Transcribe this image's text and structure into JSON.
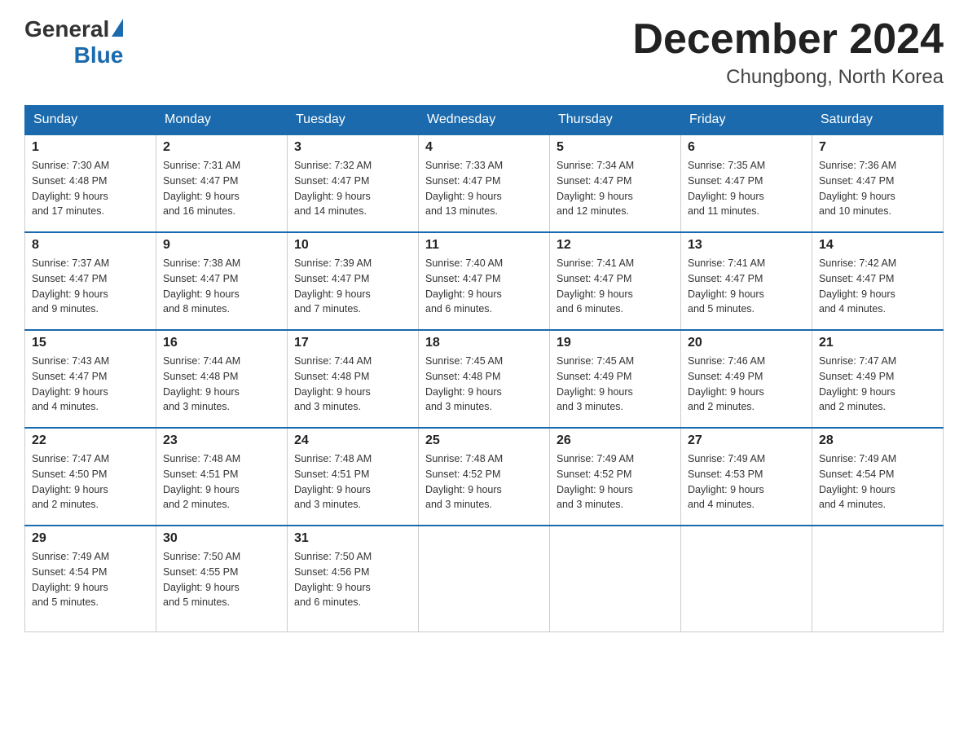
{
  "logo": {
    "general": "General",
    "blue": "Blue"
  },
  "title": {
    "month_year": "December 2024",
    "location": "Chungbong, North Korea"
  },
  "header_days": [
    "Sunday",
    "Monday",
    "Tuesday",
    "Wednesday",
    "Thursday",
    "Friday",
    "Saturday"
  ],
  "weeks": [
    [
      {
        "day": "1",
        "sunrise": "7:30 AM",
        "sunset": "4:48 PM",
        "daylight": "9 hours and 17 minutes."
      },
      {
        "day": "2",
        "sunrise": "7:31 AM",
        "sunset": "4:47 PM",
        "daylight": "9 hours and 16 minutes."
      },
      {
        "day": "3",
        "sunrise": "7:32 AM",
        "sunset": "4:47 PM",
        "daylight": "9 hours and 14 minutes."
      },
      {
        "day": "4",
        "sunrise": "7:33 AM",
        "sunset": "4:47 PM",
        "daylight": "9 hours and 13 minutes."
      },
      {
        "day": "5",
        "sunrise": "7:34 AM",
        "sunset": "4:47 PM",
        "daylight": "9 hours and 12 minutes."
      },
      {
        "day": "6",
        "sunrise": "7:35 AM",
        "sunset": "4:47 PM",
        "daylight": "9 hours and 11 minutes."
      },
      {
        "day": "7",
        "sunrise": "7:36 AM",
        "sunset": "4:47 PM",
        "daylight": "9 hours and 10 minutes."
      }
    ],
    [
      {
        "day": "8",
        "sunrise": "7:37 AM",
        "sunset": "4:47 PM",
        "daylight": "9 hours and 9 minutes."
      },
      {
        "day": "9",
        "sunrise": "7:38 AM",
        "sunset": "4:47 PM",
        "daylight": "9 hours and 8 minutes."
      },
      {
        "day": "10",
        "sunrise": "7:39 AM",
        "sunset": "4:47 PM",
        "daylight": "9 hours and 7 minutes."
      },
      {
        "day": "11",
        "sunrise": "7:40 AM",
        "sunset": "4:47 PM",
        "daylight": "9 hours and 6 minutes."
      },
      {
        "day": "12",
        "sunrise": "7:41 AM",
        "sunset": "4:47 PM",
        "daylight": "9 hours and 6 minutes."
      },
      {
        "day": "13",
        "sunrise": "7:41 AM",
        "sunset": "4:47 PM",
        "daylight": "9 hours and 5 minutes."
      },
      {
        "day": "14",
        "sunrise": "7:42 AM",
        "sunset": "4:47 PM",
        "daylight": "9 hours and 4 minutes."
      }
    ],
    [
      {
        "day": "15",
        "sunrise": "7:43 AM",
        "sunset": "4:47 PM",
        "daylight": "9 hours and 4 minutes."
      },
      {
        "day": "16",
        "sunrise": "7:44 AM",
        "sunset": "4:48 PM",
        "daylight": "9 hours and 3 minutes."
      },
      {
        "day": "17",
        "sunrise": "7:44 AM",
        "sunset": "4:48 PM",
        "daylight": "9 hours and 3 minutes."
      },
      {
        "day": "18",
        "sunrise": "7:45 AM",
        "sunset": "4:48 PM",
        "daylight": "9 hours and 3 minutes."
      },
      {
        "day": "19",
        "sunrise": "7:45 AM",
        "sunset": "4:49 PM",
        "daylight": "9 hours and 3 minutes."
      },
      {
        "day": "20",
        "sunrise": "7:46 AM",
        "sunset": "4:49 PM",
        "daylight": "9 hours and 2 minutes."
      },
      {
        "day": "21",
        "sunrise": "7:47 AM",
        "sunset": "4:49 PM",
        "daylight": "9 hours and 2 minutes."
      }
    ],
    [
      {
        "day": "22",
        "sunrise": "7:47 AM",
        "sunset": "4:50 PM",
        "daylight": "9 hours and 2 minutes."
      },
      {
        "day": "23",
        "sunrise": "7:48 AM",
        "sunset": "4:51 PM",
        "daylight": "9 hours and 2 minutes."
      },
      {
        "day": "24",
        "sunrise": "7:48 AM",
        "sunset": "4:51 PM",
        "daylight": "9 hours and 3 minutes."
      },
      {
        "day": "25",
        "sunrise": "7:48 AM",
        "sunset": "4:52 PM",
        "daylight": "9 hours and 3 minutes."
      },
      {
        "day": "26",
        "sunrise": "7:49 AM",
        "sunset": "4:52 PM",
        "daylight": "9 hours and 3 minutes."
      },
      {
        "day": "27",
        "sunrise": "7:49 AM",
        "sunset": "4:53 PM",
        "daylight": "9 hours and 4 minutes."
      },
      {
        "day": "28",
        "sunrise": "7:49 AM",
        "sunset": "4:54 PM",
        "daylight": "9 hours and 4 minutes."
      }
    ],
    [
      {
        "day": "29",
        "sunrise": "7:49 AM",
        "sunset": "4:54 PM",
        "daylight": "9 hours and 5 minutes."
      },
      {
        "day": "30",
        "sunrise": "7:50 AM",
        "sunset": "4:55 PM",
        "daylight": "9 hours and 5 minutes."
      },
      {
        "day": "31",
        "sunrise": "7:50 AM",
        "sunset": "4:56 PM",
        "daylight": "9 hours and 6 minutes."
      },
      null,
      null,
      null,
      null
    ]
  ],
  "labels": {
    "sunrise": "Sunrise:",
    "sunset": "Sunset:",
    "daylight": "Daylight:"
  }
}
